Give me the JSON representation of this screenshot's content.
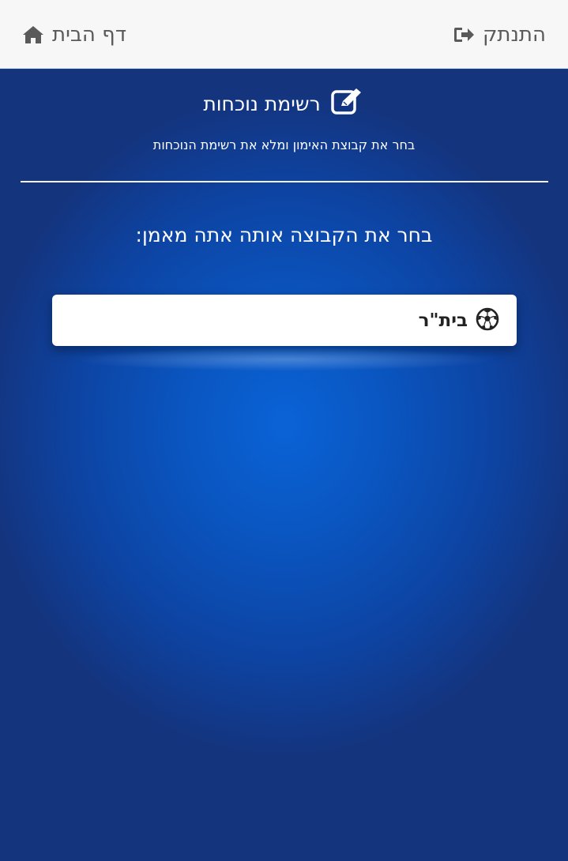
{
  "topbar": {
    "logout_label": "התנתק",
    "logout_icon": "sign-out-icon",
    "home_label": "דף הבית",
    "home_icon": "home-icon"
  },
  "header": {
    "title": "רשימת נוכחות",
    "title_icon": "edit-icon",
    "subtitle": "בחר את קבוצת האימון ומלא את רשימת הנוכחות"
  },
  "main": {
    "question": "בחר את הקבוצה אותה אתה מאמן:",
    "teams": [
      {
        "name": "בית\"ר",
        "icon": "soccer-ball-icon"
      }
    ]
  },
  "colors": {
    "topbar_bg": "#f7f7f7",
    "topbar_text": "#5a5a5a",
    "main_bg": "#0a55c0",
    "card_bg": "#ffffff",
    "text_light": "#ffffff"
  }
}
